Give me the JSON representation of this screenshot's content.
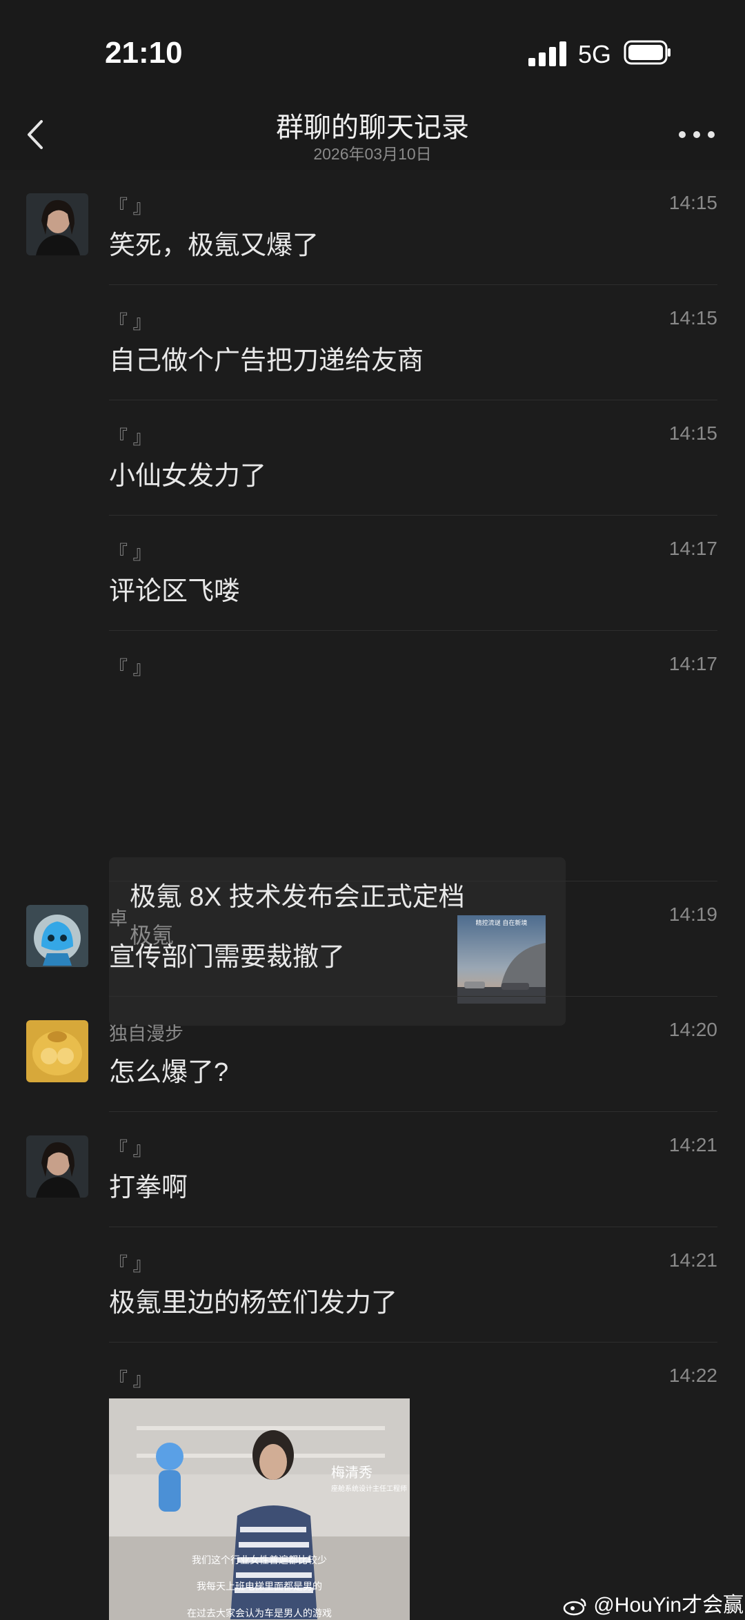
{
  "status_bar": {
    "time": "21:10",
    "network": "5G"
  },
  "header": {
    "title": "群聊的聊天记录",
    "subtitle": "2026年03月10日"
  },
  "messages": [
    {
      "sender": "『        』",
      "time": "14:15",
      "text": "笑死，极氪又爆了",
      "avatar": "avatar-portrait-woman"
    },
    {
      "sender": "『        』",
      "time": "14:15",
      "text": "自己做个广告把刀递给友商"
    },
    {
      "sender": "『        』",
      "time": "14:15",
      "text": "小仙女发力了"
    },
    {
      "sender": "『        』",
      "time": "14:17",
      "text": "评论区飞喽"
    },
    {
      "sender": "『        』",
      "time": "14:17",
      "link_card": {
        "title": "极氪 8X 技术发布会正式定档",
        "source": "极氪",
        "thumb_caption": "精控流谜 自在新境"
      }
    },
    {
      "sender": "卓",
      "time": "14:19",
      "text": "宣传部门需要裁撤了",
      "avatar": "avatar-blue-cartoon"
    },
    {
      "sender": "独自漫步",
      "time": "14:20",
      "text": "怎么爆了?",
      "avatar": "avatar-yellow"
    },
    {
      "sender": "『        』",
      "time": "14:21",
      "text": "打拳啊",
      "avatar": "avatar-portrait-woman"
    },
    {
      "sender": "『        』",
      "time": "14:21",
      "text": "极氪里边的杨笠们发力了"
    },
    {
      "sender": "『        』",
      "time": "14:22",
      "video": {
        "name_tag": "梅清秀",
        "role_tag": "座舱系统设计主任工程师",
        "subtitles": [
          "我们这个行业女性普遍都比较少",
          "我每天上班电梯里面都是男的",
          "在过去大家会认为车是男人的游戏"
        ]
      }
    }
  ],
  "watermark": "@HouYin才会赢",
  "colors": {
    "background": "#1c1c1c",
    "header": "#1a1a1a",
    "text": "#e8e8e8",
    "muted": "#8a8a8a",
    "card": "#262626"
  }
}
